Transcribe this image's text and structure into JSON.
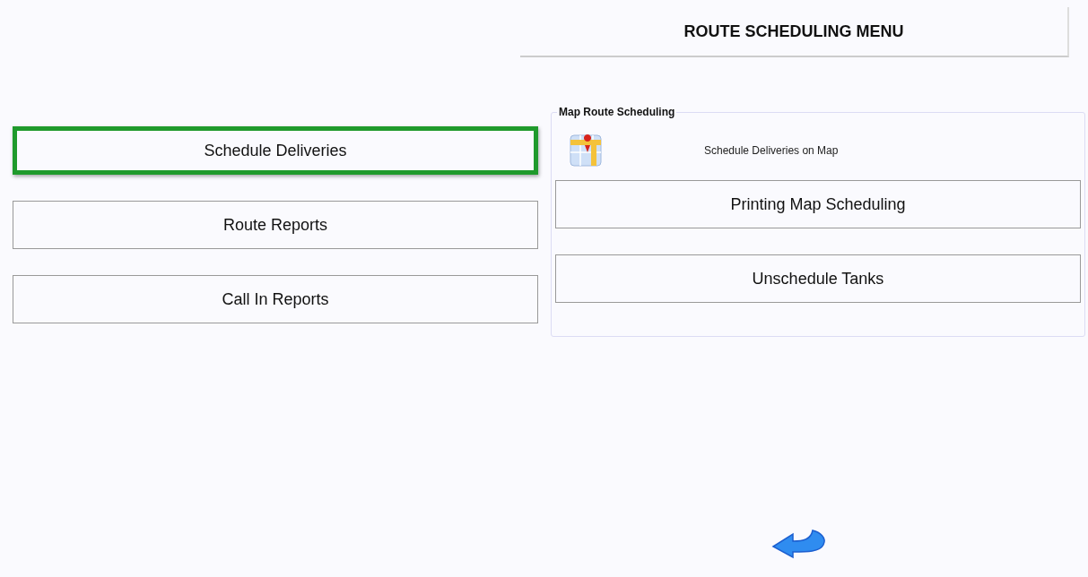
{
  "header": {
    "title": "ROUTE SCHEDULING MENU"
  },
  "menu_buttons": [
    {
      "label": "Schedule Deliveries",
      "selected": true
    },
    {
      "label": "Route Reports",
      "selected": false
    },
    {
      "label": "Call In Reports",
      "selected": false
    }
  ],
  "map_group": {
    "legend": "Map Route Scheduling",
    "map_item": {
      "label": "Schedule Deliveries on Map"
    },
    "buttons": [
      {
        "label": "Printing Map Scheduling",
        "selected": false
      },
      {
        "label": "Unschedule Tanks",
        "selected": false
      }
    ]
  }
}
